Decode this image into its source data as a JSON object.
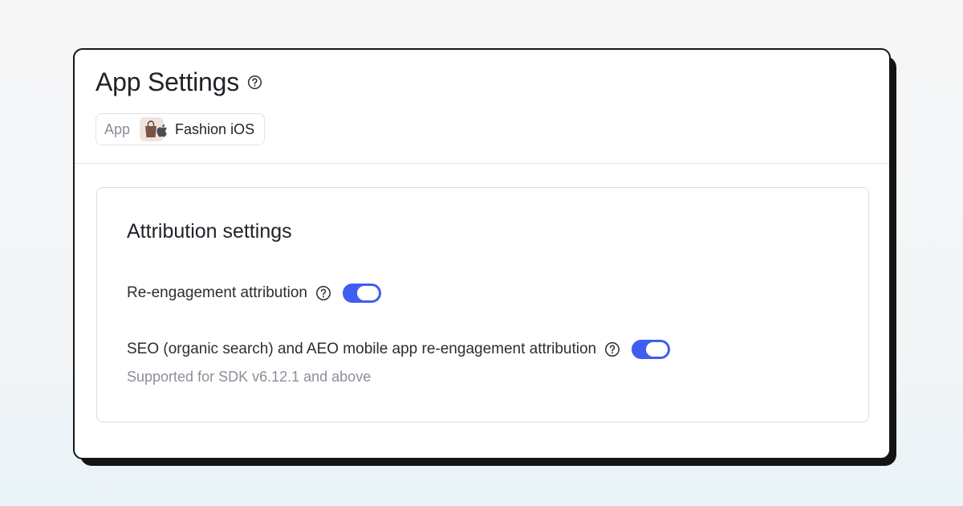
{
  "page": {
    "title": "App Settings",
    "help_icon": "question-circle-icon"
  },
  "app_selector": {
    "label": "App",
    "app_name": "Fashion iOS",
    "app_icon": "shopping-bag-icon",
    "platform_icon": "apple-icon"
  },
  "attribution": {
    "title": "Attribution settings",
    "settings": [
      {
        "label": "Re-engagement attribution",
        "help_icon": "question-circle-icon",
        "enabled": true
      },
      {
        "label": "SEO (organic search) and AEO mobile app re-engagement attribution",
        "help_icon": "question-circle-icon",
        "enabled": true,
        "note": "Supported for SDK v6.12.1 and above"
      }
    ]
  },
  "colors": {
    "toggle_on": "#3f5ef0",
    "title_text": "#1f2328",
    "muted_text": "#8a9099",
    "border": "#dcdfe3"
  }
}
